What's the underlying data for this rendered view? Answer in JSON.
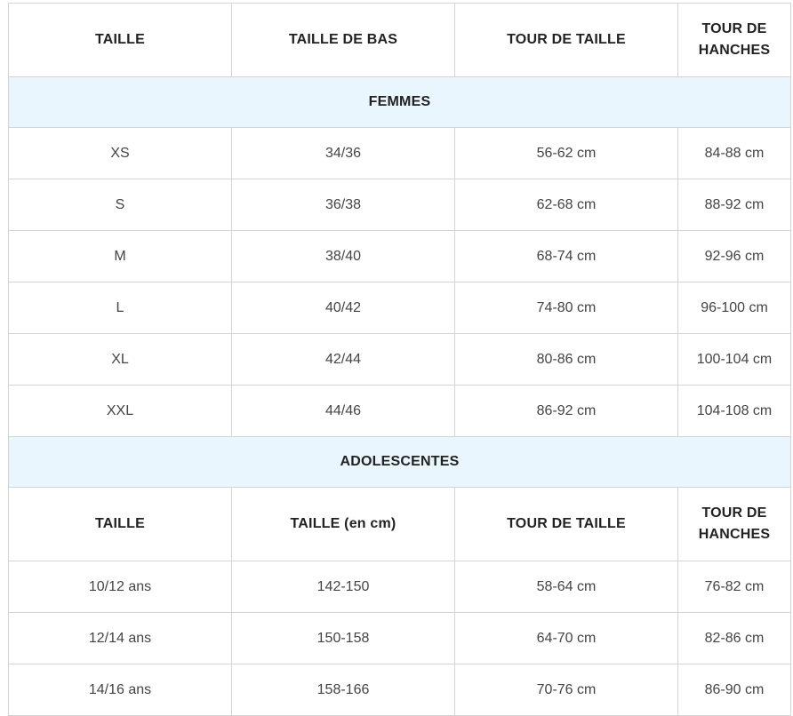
{
  "header": {
    "col1": "TAILLE",
    "col2": "TAILLE DE BAS",
    "col3": "TOUR DE TAILLE",
    "col4": "TOUR DE HANCHES"
  },
  "femmes": {
    "title": "FEMMES",
    "rows": [
      {
        "taille": "XS",
        "bas": "34/36",
        "tour_taille": "56-62 cm",
        "hanches": "84-88 cm"
      },
      {
        "taille": "S",
        "bas": "36/38",
        "tour_taille": "62-68 cm",
        "hanches": "88-92 cm"
      },
      {
        "taille": "M",
        "bas": "38/40",
        "tour_taille": "68-74 cm",
        "hanches": "92-96 cm"
      },
      {
        "taille": "L",
        "bas": "40/42",
        "tour_taille": "74-80 cm",
        "hanches": "96-100 cm"
      },
      {
        "taille": "XL",
        "bas": "42/44",
        "tour_taille": "80-86 cm",
        "hanches": "100-104 cm"
      },
      {
        "taille": "XXL",
        "bas": "44/46",
        "tour_taille": "86-92 cm",
        "hanches": "104-108 cm"
      }
    ]
  },
  "adolescentes": {
    "title": "ADOLESCENTES",
    "header": {
      "col1": "TAILLE",
      "col2": "TAILLE (en cm)",
      "col3": "TOUR DE TAILLE",
      "col4": "TOUR DE HANCHES"
    },
    "rows": [
      {
        "taille": "10/12 ans",
        "cm": "142-150",
        "tour_taille": "58-64 cm",
        "hanches": "76-82 cm"
      },
      {
        "taille": "12/14 ans",
        "cm": "150-158",
        "tour_taille": "64-70 cm",
        "hanches": "82-86 cm"
      },
      {
        "taille": "14/16 ans",
        "cm": "158-166",
        "tour_taille": "70-76 cm",
        "hanches": "86-90 cm"
      }
    ]
  }
}
